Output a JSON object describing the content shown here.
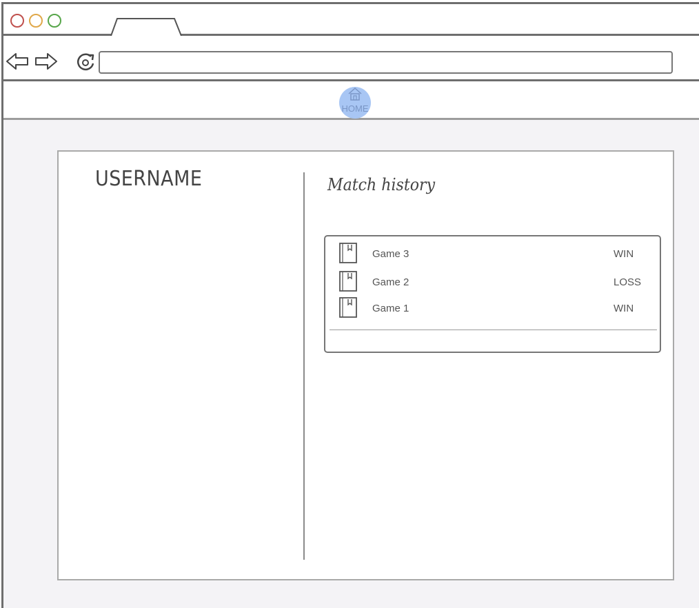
{
  "browser": {
    "controls": {
      "close": "close-dot",
      "minimize": "minimize-dot",
      "maximize": "maximize-dot"
    },
    "address_bar": {
      "value": ""
    }
  },
  "home": {
    "label": "HOME",
    "icon": "home-icon",
    "accent_color": "#a8c6f4"
  },
  "profile": {
    "username": "USERNAME"
  },
  "match_history": {
    "title": "Match history",
    "matches": [
      {
        "name": "Game 3",
        "result": "WIN",
        "icon": "document-icon"
      },
      {
        "name": "Game 2",
        "result": "LOSS",
        "icon": "document-icon"
      },
      {
        "name": "Game 1",
        "result": "WIN",
        "icon": "document-icon"
      }
    ]
  }
}
